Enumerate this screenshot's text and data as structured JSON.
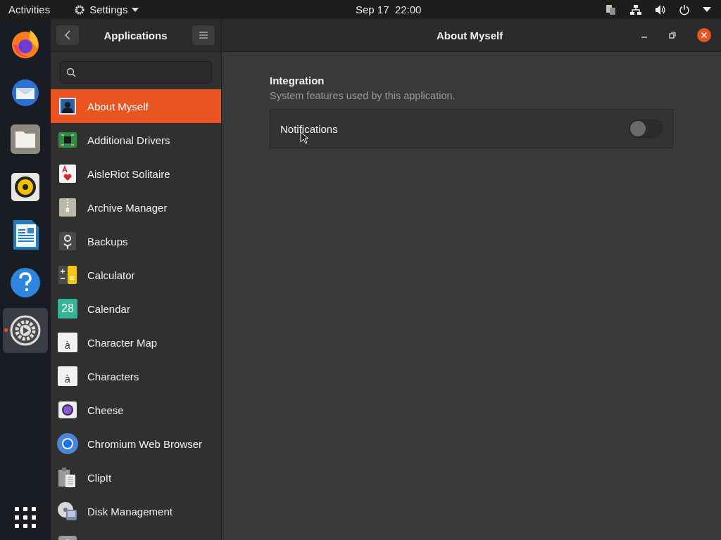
{
  "top_bar": {
    "activities": "Activities",
    "app_menu": "Settings",
    "clock": "Sep 17  22:00"
  },
  "dock": [
    {
      "kind": "firefox",
      "running": false
    },
    {
      "kind": "mail",
      "running": false
    },
    {
      "kind": "files",
      "running": false
    },
    {
      "kind": "speaker",
      "running": false
    },
    {
      "kind": "writer",
      "running": false
    },
    {
      "kind": "help",
      "running": false
    },
    {
      "kind": "settings",
      "running": true
    }
  ],
  "sidebar": {
    "title": "Applications",
    "items": [
      {
        "kind": "person",
        "label": "About Myself",
        "selected": true
      },
      {
        "kind": "chip",
        "label": "Additional Drivers",
        "selected": false
      },
      {
        "kind": "cards",
        "label": "AisleRiot Solitaire",
        "selected": false
      },
      {
        "kind": "zip",
        "label": "Archive Manager",
        "selected": false
      },
      {
        "kind": "backup",
        "label": "Backups",
        "selected": false
      },
      {
        "kind": "calc",
        "label": "Calculator",
        "selected": false
      },
      {
        "kind": "calendar",
        "glyph": "28",
        "label": "Calendar",
        "selected": false
      },
      {
        "kind": "glyph",
        "glyph": "à",
        "label": "Character Map",
        "selected": false
      },
      {
        "kind": "glyph",
        "glyph": "à",
        "label": "Characters",
        "selected": false
      },
      {
        "kind": "camera",
        "label": "Cheese",
        "selected": false
      },
      {
        "kind": "browser",
        "label": "Chromium Web Browser",
        "selected": false
      },
      {
        "kind": "clipboard",
        "label": "ClipIt",
        "selected": false
      },
      {
        "kind": "disk",
        "label": "Disk Management",
        "selected": false
      },
      {
        "kind": "generic",
        "selected": false
      }
    ]
  },
  "content": {
    "title": "About Myself",
    "section": {
      "title": "Integration",
      "subtitle": "System features used by this application."
    },
    "rows": [
      {
        "label": "Notifications",
        "on": false
      }
    ]
  }
}
